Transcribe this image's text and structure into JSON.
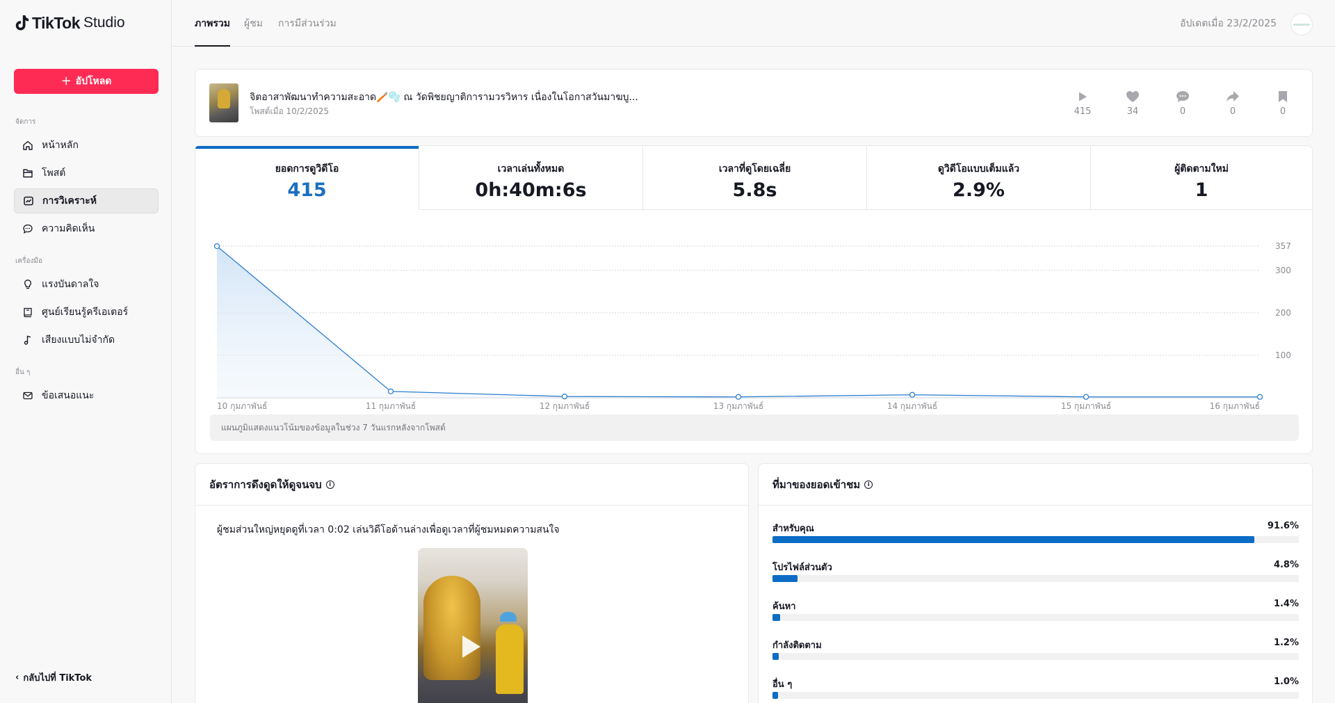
{
  "app": {
    "brand": "TikTok",
    "product": "Studio"
  },
  "sidebar": {
    "upload_label": "อัปโหลด",
    "sections": {
      "manage": "จัดการ",
      "tools": "เครื่องมือ",
      "others": "อื่น ๆ"
    },
    "items": [
      {
        "label": "หน้าหลัก",
        "icon": "home-icon"
      },
      {
        "label": "โพสต์",
        "icon": "folder-icon"
      },
      {
        "label": "การวิเคราะห์",
        "icon": "analytics-icon",
        "active": true
      },
      {
        "label": "ความคิดเห็น",
        "icon": "comment-icon"
      },
      {
        "label": "แรงบันดาลใจ",
        "icon": "lightbulb-icon"
      },
      {
        "label": "ศูนย์เรียนรู้ครีเอเตอร์",
        "icon": "book-icon"
      },
      {
        "label": "เสียงแบบไม่จำกัด",
        "icon": "music-note-icon"
      },
      {
        "label": "ข้อเสนอแนะ",
        "icon": "mail-icon"
      }
    ],
    "back_label": "กลับไปที่ TikTok"
  },
  "topbar": {
    "tabs": [
      {
        "label": "ภาพรวม",
        "active": true
      },
      {
        "label": "ผู้ชม"
      },
      {
        "label": "การมีส่วนร่วม"
      }
    ],
    "updated": "อัปเดตเมื่อ 23/2/2025"
  },
  "video": {
    "title": "จิตอาสาพัฒนาทำความสะอาด🪥🫧 ณ วัดพิชยญาติการามวรวิหาร เนื่องในโอกาสวันมาฆบู...",
    "posted": "โพสต์เมื่อ 10/2/2025",
    "stats": {
      "plays": "415",
      "likes": "34",
      "comments": "0",
      "shares": "0",
      "saves": "0"
    }
  },
  "metrics": [
    {
      "label": "ยอดการดูวิดีโอ",
      "value": "415"
    },
    {
      "label": "เวลาเล่นทั้งหมด",
      "value": "0h:40m:6s"
    },
    {
      "label": "เวลาที่ดูโดยเฉลี่ย",
      "value": "5.8s"
    },
    {
      "label": "ดูวิดีโอแบบเต็มแล้ว",
      "value": "2.9%"
    },
    {
      "label": "ผู้ติดตามใหม่",
      "value": "1"
    }
  ],
  "chart_data": {
    "type": "area",
    "categories": [
      "10 กุมภาพันธ์",
      "11 กุมภาพันธ์",
      "12 กุมภาพันธ์",
      "13 กุมภาพันธ์",
      "14 กุมภาพันธ์",
      "15 กุมภาพันธ์",
      "16 กุมภาพันธ์"
    ],
    "values": [
      357,
      15,
      3,
      2,
      7,
      2,
      2
    ],
    "yticks": [
      100,
      200,
      300,
      357
    ],
    "ylim": [
      0,
      357
    ],
    "grid": true,
    "color": "#2d7fd0",
    "note": "แผนภูมิแสดงแนวโน้มของข้อมูลในช่วง 7 วันแรกหลังจากโพสต์"
  },
  "retention": {
    "title": "อัตราการดึงดูดให้ดูจนจบ",
    "text": "ผู้ชมส่วนใหญ่หยุดดูที่เวลา 0:02 เล่นวิดีโอด้านล่างเพื่อดูเวลาที่ผู้ชมหมดความสนใจ"
  },
  "traffic": {
    "title": "ที่มาของยอดเข้าชม",
    "sources": [
      {
        "name": "สำหรับคุณ",
        "pct": "91.6%",
        "value": 91.6
      },
      {
        "name": "โปรไฟล์ส่วนตัว",
        "pct": "4.8%",
        "value": 4.8
      },
      {
        "name": "ค้นหา",
        "pct": "1.4%",
        "value": 1.4
      },
      {
        "name": "กำลังติดตาม",
        "pct": "1.2%",
        "value": 1.2
      },
      {
        "name": "อื่น ๆ",
        "pct": "1.0%",
        "value": 1.0
      }
    ]
  }
}
